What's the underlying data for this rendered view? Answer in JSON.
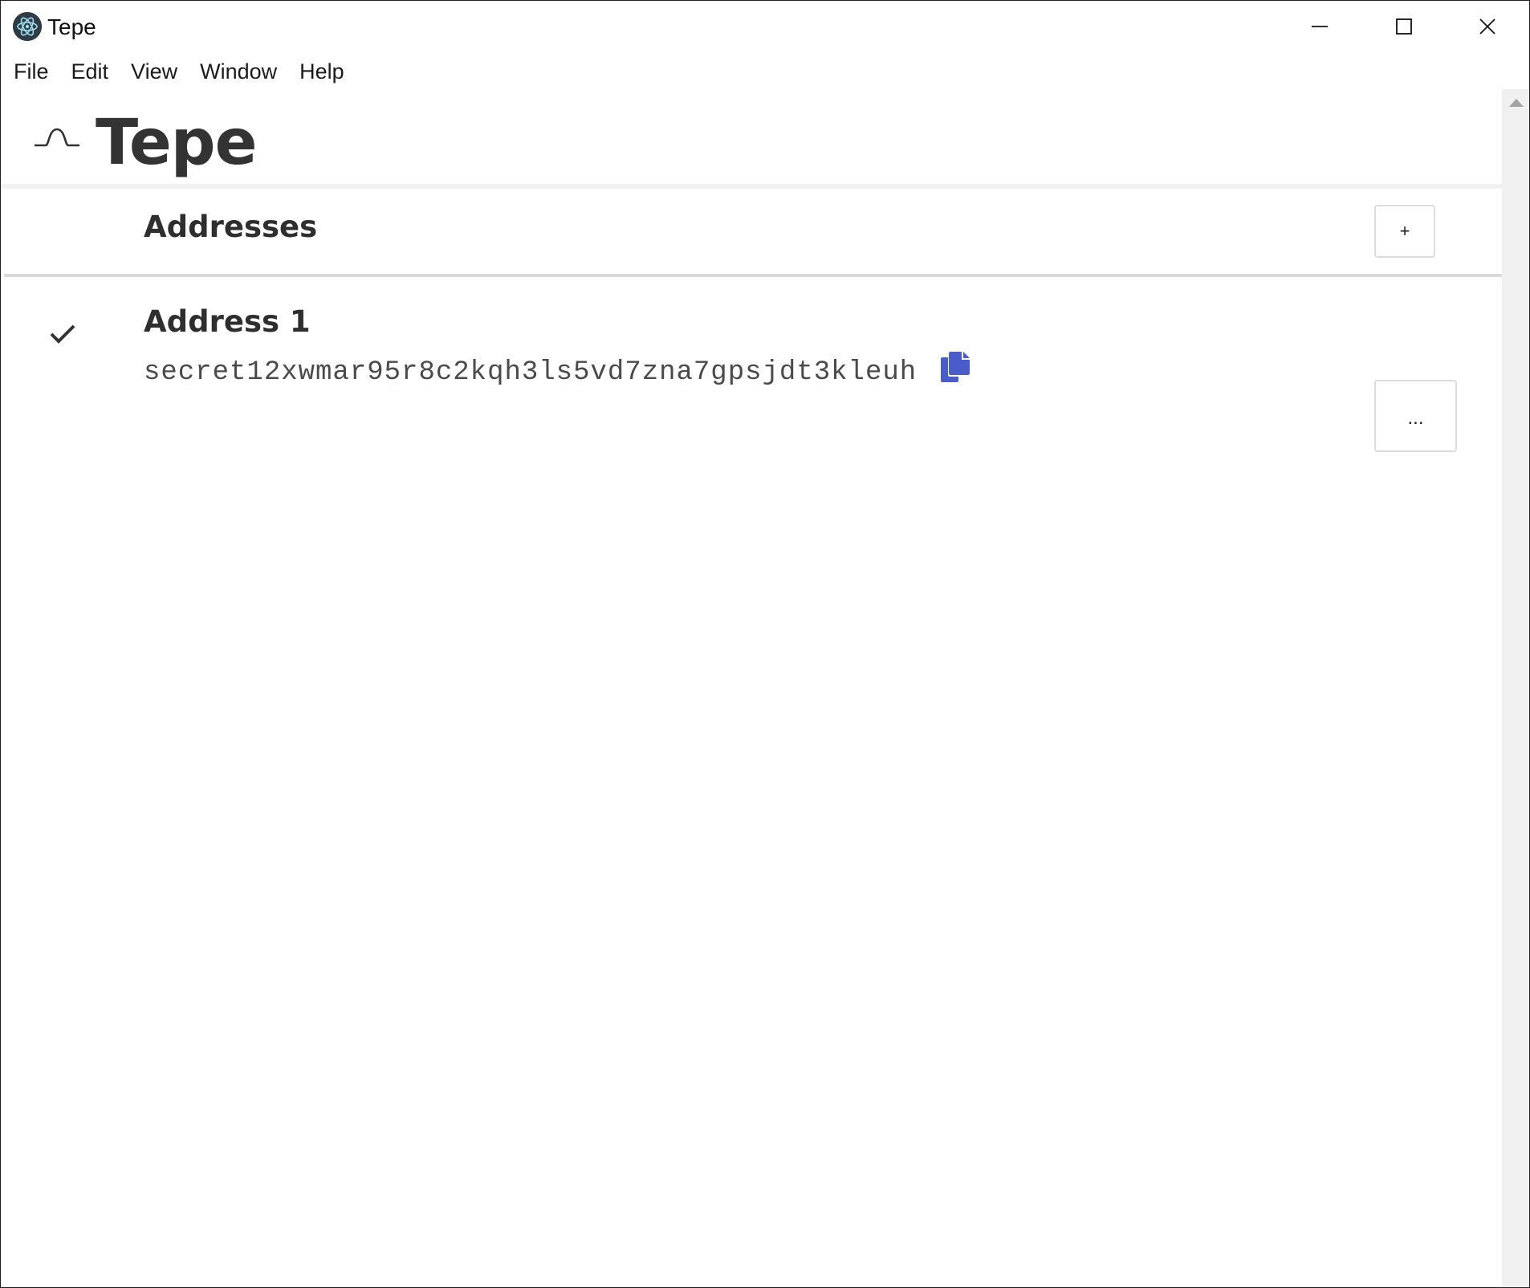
{
  "window": {
    "title": "Tepe",
    "controls": {
      "minimize": "minimize-icon",
      "maximize": "maximize-icon",
      "close": "close-icon"
    }
  },
  "menu": {
    "items": [
      "File",
      "Edit",
      "View",
      "Window",
      "Help"
    ]
  },
  "header": {
    "logo_icon": "signal-wave-icon",
    "title": "Tepe"
  },
  "addresses": {
    "title": "Addresses",
    "add_label": "+",
    "items": [
      {
        "name": "Address 1",
        "value": "secret12xwmar95r8c2kqh3ls5vd7zna7gpsjdt3kleuh",
        "selected": true,
        "more_label": "..."
      }
    ]
  },
  "colors": {
    "accent": "#4a5cc9",
    "text": "#2e2e2e",
    "border": "#dcdcdc"
  }
}
